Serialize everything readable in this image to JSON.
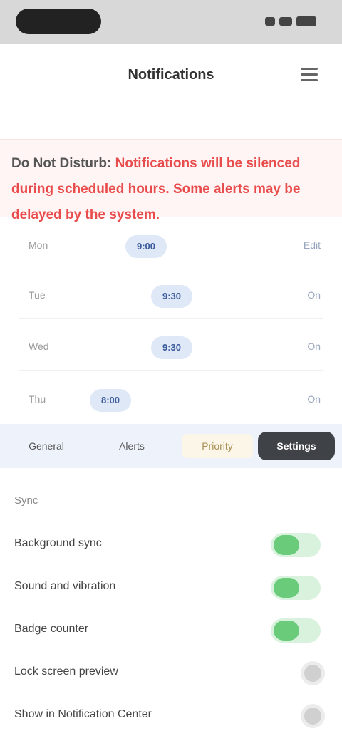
{
  "header": {
    "title": "Notifications"
  },
  "banner": {
    "dark_text": "Do Not Disturb:",
    "red_text": "Notifications will be silenced during scheduled hours. Some alerts may be delayed by the system."
  },
  "schedule": {
    "rows": [
      {
        "label": "Mon",
        "pill": "9:00",
        "right": "Edit"
      },
      {
        "label": "Tue",
        "pill": "9:30",
        "right": "On"
      },
      {
        "label": "Wed",
        "pill": "9:30",
        "right": "On"
      },
      {
        "label": "Thu",
        "pill": "8:00",
        "right": "On"
      }
    ]
  },
  "tabs": {
    "items": [
      {
        "label": "General"
      },
      {
        "label": "Alerts"
      },
      {
        "label": "Priority"
      },
      {
        "label": "Settings",
        "active": true
      }
    ]
  },
  "settings": {
    "section_label": "Sync",
    "rows": [
      {
        "label": "Background sync",
        "on": true
      },
      {
        "label": "Sound and vibration",
        "on": true
      },
      {
        "label": "Badge counter",
        "on": true
      },
      {
        "label": "Lock screen preview",
        "on": false
      },
      {
        "label": "Show in Notification Center",
        "on": false
      }
    ]
  },
  "colors": {
    "accent_green": "#6acb7a",
    "banner_red": "#e94c4c",
    "active_tab": "#3f4247"
  }
}
